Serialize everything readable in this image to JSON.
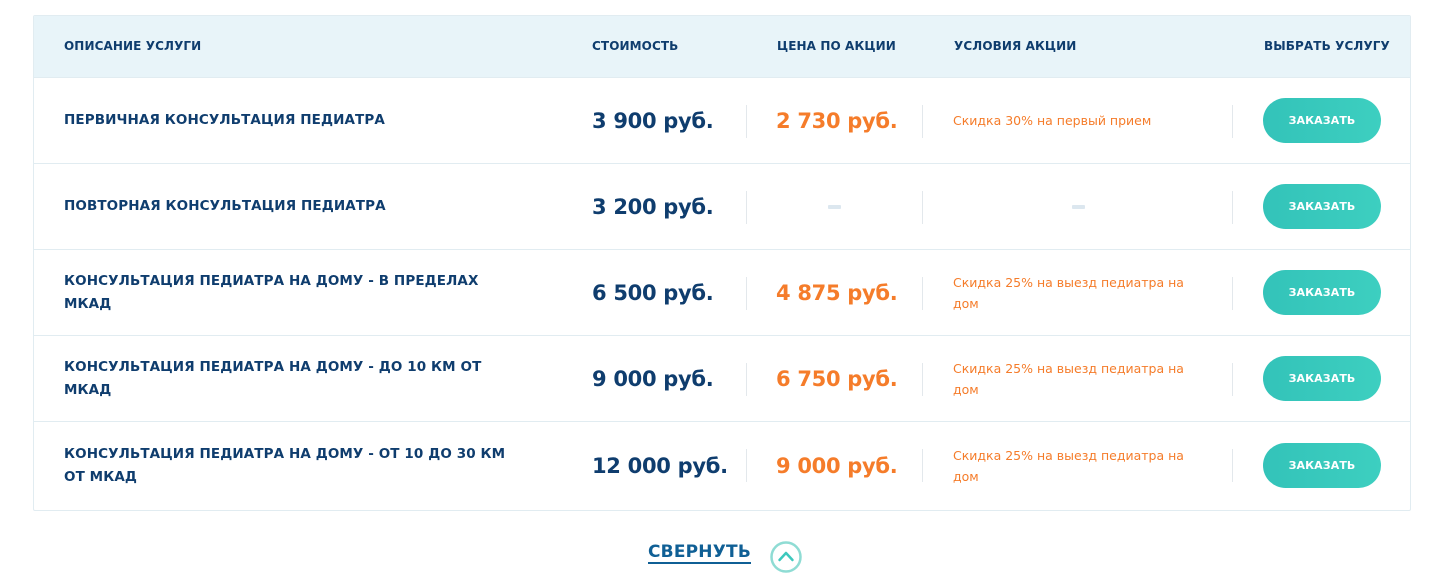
{
  "header": {
    "col_description": "ОПИСАНИЕ УСЛУГИ",
    "col_price": "СТОИМОСТЬ",
    "col_promo_price": "ЦЕНА ПО АКЦИИ",
    "col_promo_conditions": "УСЛОВИЯ АКЦИИ",
    "col_select": "ВЫБРАТЬ УСЛУГУ"
  },
  "rows": [
    {
      "name": "ПЕРВИЧНАЯ КОНСУЛЬТАЦИЯ ПЕДИАТРА",
      "price": "3 900 руб.",
      "promo_price": "2 730 руб.",
      "conditions": "Скидка 30% на первый прием",
      "button": "ЗАКАЗАТЬ"
    },
    {
      "name": "ПОВТОРНАЯ КОНСУЛЬТАЦИЯ ПЕДИАТРА",
      "price": "3 200 руб.",
      "promo_price": "",
      "conditions": "",
      "button": "ЗАКАЗАТЬ"
    },
    {
      "name": "КОНСУЛЬТАЦИЯ ПЕДИАТРА НА ДОМУ - В ПРЕДЕЛАХ МКАД",
      "price": "6 500 руб.",
      "promo_price": "4 875 руб.",
      "conditions": "Скидка 25% на выезд педиатра на дом",
      "button": "ЗАКАЗАТЬ"
    },
    {
      "name": "КОНСУЛЬТАЦИЯ ПЕДИАТРА НА ДОМУ - ДО 10 КМ ОТ МКАД",
      "price": "9 000 руб.",
      "promo_price": "6 750 руб.",
      "conditions": "Скидка 25% на выезд педиатра на дом",
      "button": "ЗАКАЗАТЬ"
    },
    {
      "name": "КОНСУЛЬТАЦИЯ ПЕДИАТРА НА ДОМУ - ОТ 10 ДО 30 КМ ОТ МКАД",
      "price": "12 000 руб.",
      "promo_price": "9 000 руб.",
      "conditions": "Скидка 25% на выезд педиатра на дом",
      "button": "ЗАКАЗАТЬ"
    }
  ],
  "collapse": {
    "label": "СВЕРНУТЬ",
    "icon": "chevron-up-circle-icon"
  },
  "colors": {
    "heading": "#0f3d6e",
    "accent_orange": "#f57c2a",
    "button_teal": "#33c3b9",
    "header_bg": "#e8f4f9"
  }
}
